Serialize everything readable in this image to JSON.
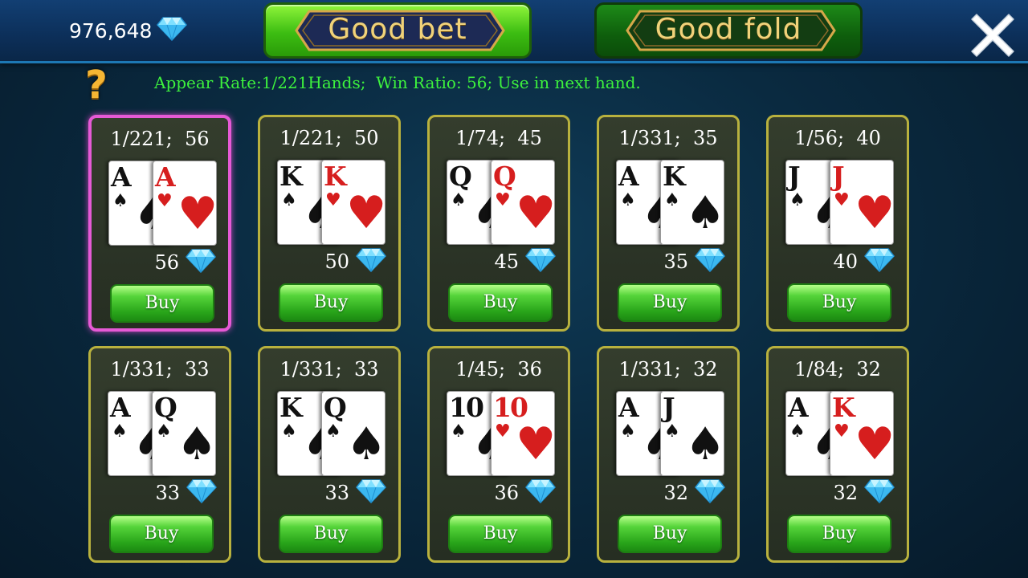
{
  "header": {
    "balance": "976,648",
    "tabs": [
      {
        "label": "Good bet",
        "active": true
      },
      {
        "label": "Good fold",
        "active": false
      }
    ]
  },
  "info_line": "Appear Rate:1/221Hands;  Win Ratio: 56; Use in next hand.",
  "buy_label": "Buy",
  "hands": [
    {
      "rate": "1/221;  56",
      "price": "56",
      "selected": true,
      "cards": [
        {
          "rank": "A",
          "suit": "♠",
          "color": "black"
        },
        {
          "rank": "A",
          "suit": "♥",
          "color": "red"
        }
      ]
    },
    {
      "rate": "1/221;  50",
      "price": "50",
      "selected": false,
      "cards": [
        {
          "rank": "K",
          "suit": "♠",
          "color": "black"
        },
        {
          "rank": "K",
          "suit": "♥",
          "color": "red"
        }
      ]
    },
    {
      "rate": "1/74;  45",
      "price": "45",
      "selected": false,
      "cards": [
        {
          "rank": "Q",
          "suit": "♠",
          "color": "black"
        },
        {
          "rank": "Q",
          "suit": "♥",
          "color": "red"
        }
      ]
    },
    {
      "rate": "1/331;  35",
      "price": "35",
      "selected": false,
      "cards": [
        {
          "rank": "A",
          "suit": "♠",
          "color": "black"
        },
        {
          "rank": "K",
          "suit": "♠",
          "color": "black"
        }
      ]
    },
    {
      "rate": "1/56;  40",
      "price": "40",
      "selected": false,
      "cards": [
        {
          "rank": "J",
          "suit": "♠",
          "color": "black"
        },
        {
          "rank": "J",
          "suit": "♥",
          "color": "red"
        }
      ]
    },
    {
      "rate": "1/331;  33",
      "price": "33",
      "selected": false,
      "cards": [
        {
          "rank": "A",
          "suit": "♠",
          "color": "black"
        },
        {
          "rank": "Q",
          "suit": "♠",
          "color": "black"
        }
      ]
    },
    {
      "rate": "1/331;  33",
      "price": "33",
      "selected": false,
      "cards": [
        {
          "rank": "K",
          "suit": "♠",
          "color": "black"
        },
        {
          "rank": "Q",
          "suit": "♠",
          "color": "black"
        }
      ]
    },
    {
      "rate": "1/45;  36",
      "price": "36",
      "selected": false,
      "cards": [
        {
          "rank": "10",
          "suit": "♠",
          "color": "black"
        },
        {
          "rank": "10",
          "suit": "♥",
          "color": "red"
        }
      ]
    },
    {
      "rate": "1/331;  32",
      "price": "32",
      "selected": false,
      "cards": [
        {
          "rank": "A",
          "suit": "♠",
          "color": "black"
        },
        {
          "rank": "J",
          "suit": "♠",
          "color": "black"
        }
      ]
    },
    {
      "rate": "1/84;  32",
      "price": "32",
      "selected": false,
      "cards": [
        {
          "rank": "A",
          "suit": "♠",
          "color": "black"
        },
        {
          "rank": "K",
          "suit": "♥",
          "color": "red"
        }
      ]
    }
  ],
  "icons": {
    "currency": "diamond-icon",
    "help": "question-mark-icon",
    "close": "close-x-icon"
  },
  "colors": {
    "info_text": "#3df23d",
    "selected_border": "#e65ad6",
    "slot_border": "#b8b13e",
    "rank_label": "#f0d27a"
  }
}
